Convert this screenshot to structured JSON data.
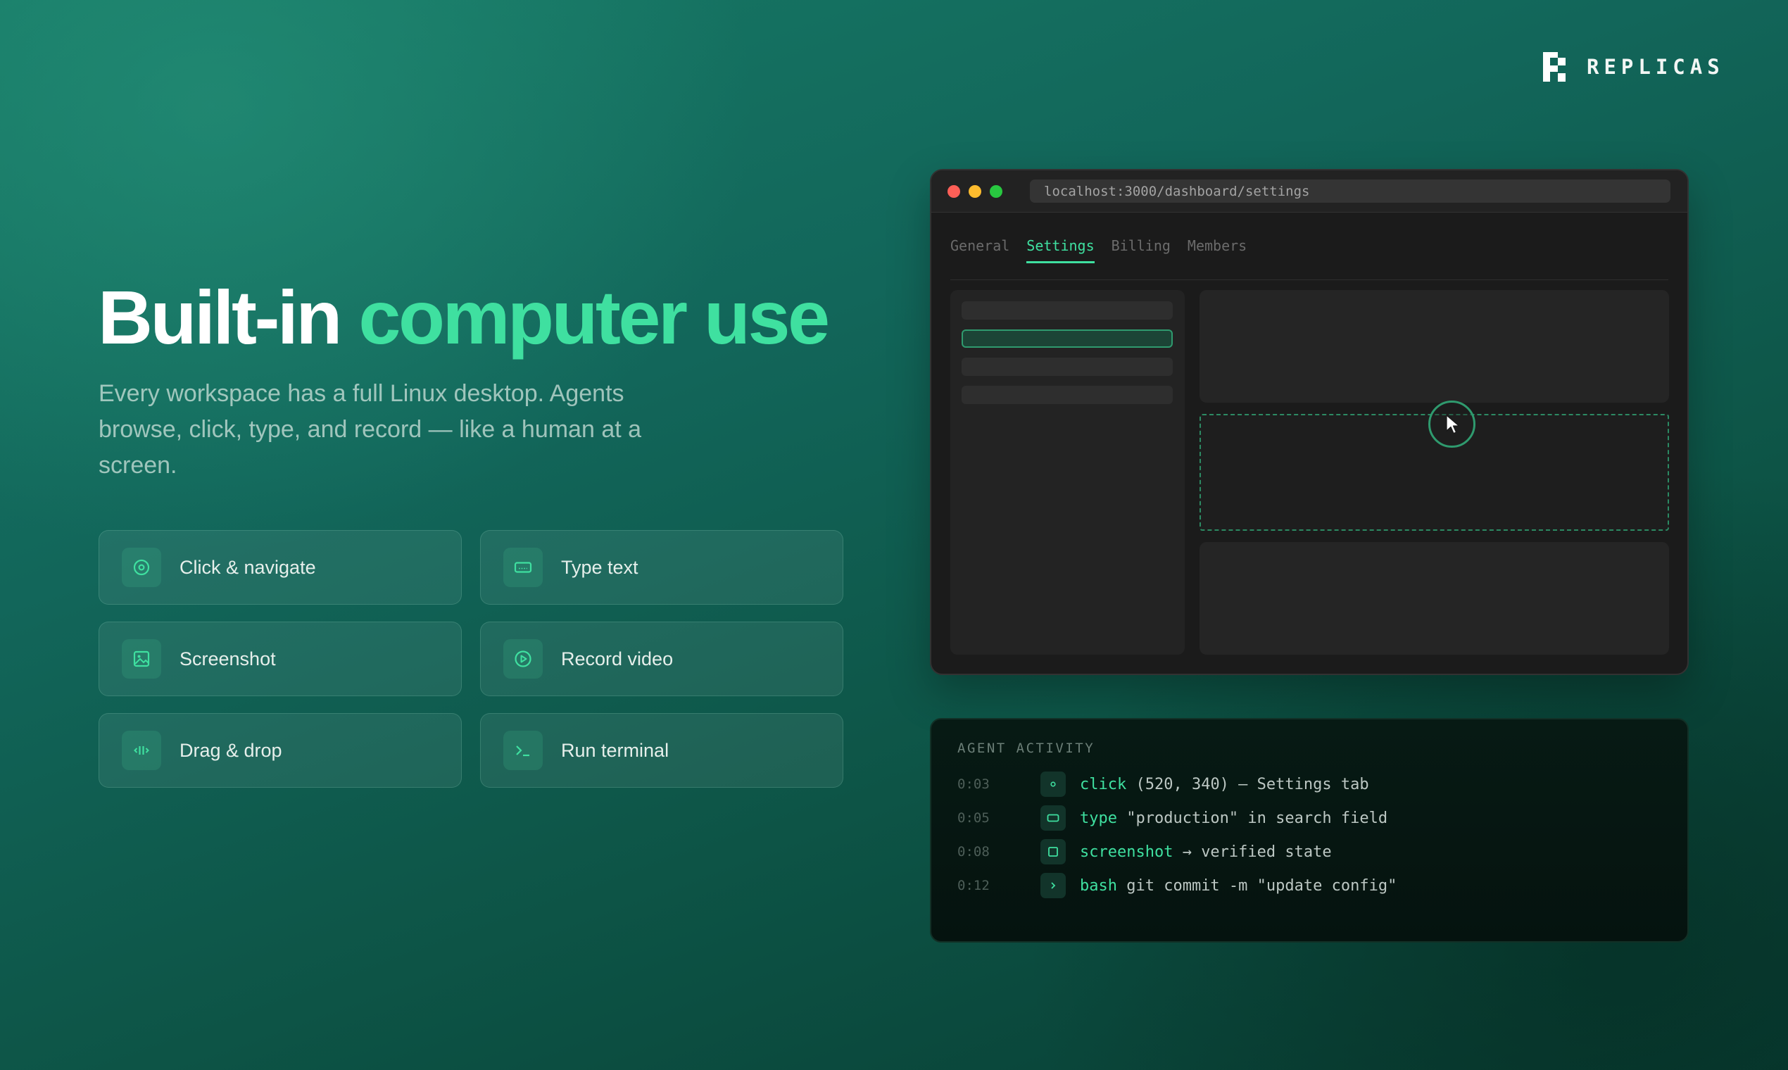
{
  "brand": {
    "name": "REPLICAS",
    "logo_icon": "replicas-logo-icon"
  },
  "hero": {
    "title_lead": "Built-in",
    "title_accent": "computer use",
    "subtitle": "Every workspace has a full Linux desktop. Agents browse, click, type, and record — like a human at a screen."
  },
  "features": [
    {
      "label": "Click & navigate",
      "icon": "target-icon"
    },
    {
      "label": "Type text",
      "icon": "keyboard-icon"
    },
    {
      "label": "Screenshot",
      "icon": "image-icon"
    },
    {
      "label": "Record video",
      "icon": "play-circle-icon"
    },
    {
      "label": "Drag & drop",
      "icon": "drag-handle-icon"
    },
    {
      "label": "Run terminal",
      "icon": "terminal-icon"
    }
  ],
  "browser": {
    "url": "localhost:3000/dashboard/settings",
    "tabs": [
      {
        "label": "General",
        "active": false
      },
      {
        "label": "Settings",
        "active": true
      },
      {
        "label": "Billing",
        "active": false
      },
      {
        "label": "Members",
        "active": false
      }
    ]
  },
  "activity": {
    "title": "AGENT ACTIVITY",
    "entries": [
      {
        "time": "0:03",
        "command": "click",
        "detail": " (520, 340) — Settings tab",
        "icon": "click-dot-icon"
      },
      {
        "time": "0:05",
        "command": "type",
        "detail": " \"production\" in search field",
        "icon": "keyboard-icon"
      },
      {
        "time": "0:08",
        "command": "screenshot",
        "detail": " → verified state",
        "icon": "square-icon"
      },
      {
        "time": "0:12",
        "command": "bash",
        "detail": " git commit -m \"update config\"",
        "icon": "chevron-right-icon"
      }
    ]
  },
  "colors": {
    "accent": "#3fe0a0",
    "background_top": "#177a66",
    "background_bottom": "#083c32",
    "traffic_red": "#fe5f57",
    "traffic_yellow": "#febc2e",
    "traffic_green": "#28c840"
  }
}
